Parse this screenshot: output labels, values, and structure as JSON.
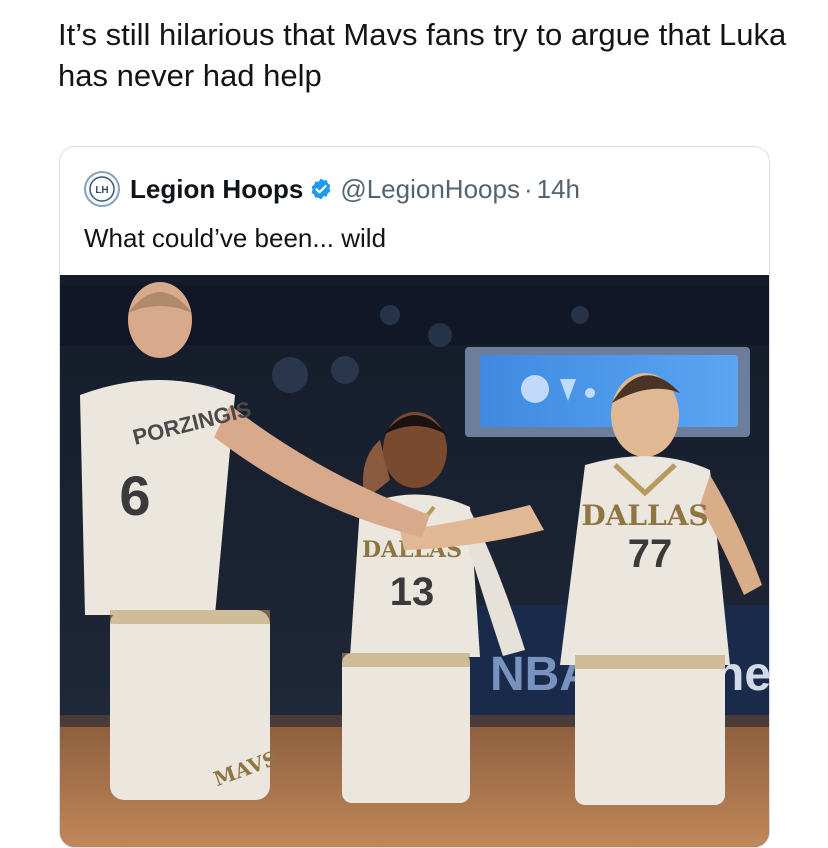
{
  "post": {
    "caption": "It’s still hilarious that Mavs fans try to argue that Luka has never had help"
  },
  "quoted_tweet": {
    "author_name": "Legion Hoops",
    "handle": "@LegionHoops",
    "separator": "·",
    "time": "14h",
    "text": "What could’ve been... wild",
    "avatar_text": "LH",
    "photo": {
      "jersey_left_name": "PORZINGIS",
      "jersey_left_number": "6",
      "jersey_center_text": "DALLAS",
      "jersey_center_number": "13",
      "jersey_right_text": "DALLAS",
      "jersey_right_number": "77",
      "shorts_text": "MAVS",
      "court_sign_left": "NBA",
      "court_sign_right": "he"
    }
  },
  "colors": {
    "verified": "#1d9bf0",
    "jersey": "#ebe7df",
    "trim": "#b89a5e",
    "arena": "#1b2435",
    "court": "#b07a50"
  }
}
